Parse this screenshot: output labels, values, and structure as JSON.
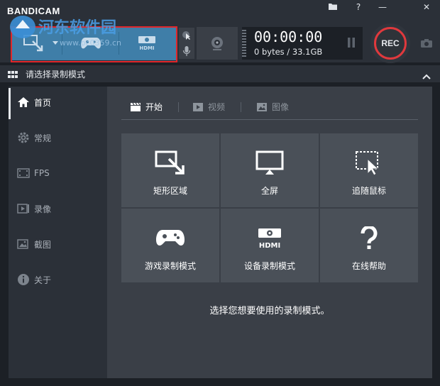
{
  "app": {
    "name": "BANDICAM"
  },
  "watermark": {
    "text": "河东软件园",
    "url": "www.pc0359.cn"
  },
  "window_controls": {
    "folder": "▬",
    "help": "?",
    "minimize": "—",
    "close": "✕"
  },
  "recorder": {
    "time": "00:00:00",
    "size": "0 bytes / 33.1GB",
    "rec_label": "REC"
  },
  "header": {
    "title": "请选择录制模式"
  },
  "sidebar": {
    "items": [
      {
        "label": "首页",
        "icon": "home-icon",
        "active": true
      },
      {
        "label": "常规",
        "icon": "gear-icon",
        "active": false
      },
      {
        "label": "FPS",
        "icon": "fps-icon",
        "active": false
      },
      {
        "label": "录像",
        "icon": "video-icon",
        "active": false
      },
      {
        "label": "截图",
        "icon": "image-icon",
        "active": false
      },
      {
        "label": "关于",
        "icon": "info-icon",
        "active": false
      }
    ]
  },
  "tabs": [
    {
      "label": "开始",
      "icon": "clapper-icon",
      "active": true
    },
    {
      "label": "视频",
      "icon": "play-icon",
      "active": false
    },
    {
      "label": "图像",
      "icon": "picture-icon",
      "active": false
    }
  ],
  "tiles": [
    {
      "label": "矩形区域",
      "icon": "rectangle-area-icon"
    },
    {
      "label": "全屏",
      "icon": "monitor-icon"
    },
    {
      "label": "追随鼠标",
      "icon": "cursor-follow-icon"
    },
    {
      "label": "游戏录制模式",
      "icon": "gamepad-icon"
    },
    {
      "label": "设备录制模式",
      "icon": "hdmi-icon"
    },
    {
      "label": "在线帮助",
      "icon": "question-icon"
    }
  ],
  "main": {
    "prompt": "选择您想要使用的录制模式。"
  },
  "colors": {
    "accent": "#3f7ea8",
    "rec_ring": "#e0393d",
    "highlight": "#e0272c"
  }
}
